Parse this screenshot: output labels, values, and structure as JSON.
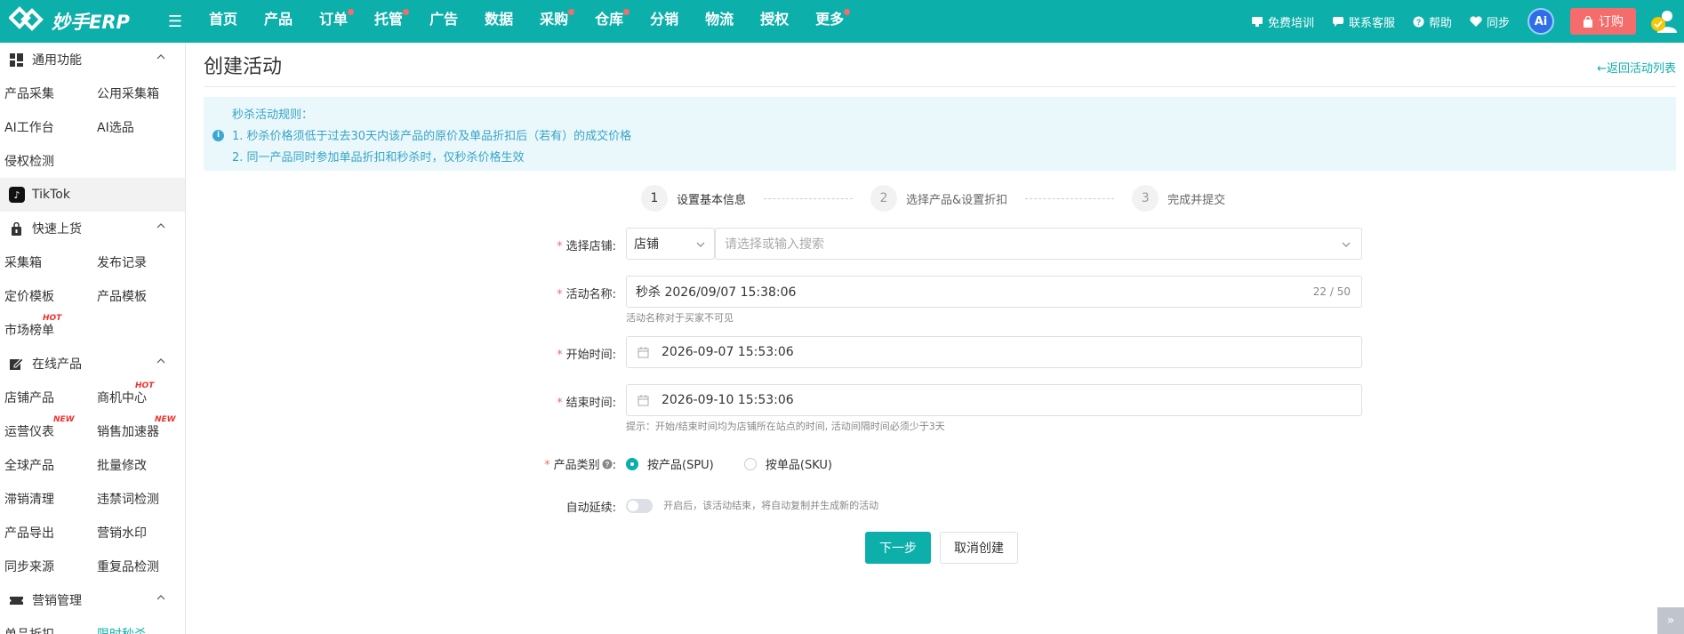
{
  "brand": {
    "name": "妙手ERP",
    "accent": "#0dafab"
  },
  "nav": [
    {
      "label": "首页",
      "dot": false
    },
    {
      "label": "产品",
      "dot": false
    },
    {
      "label": "订单",
      "dot": true
    },
    {
      "label": "托管",
      "dot": true
    },
    {
      "label": "广告",
      "dot": false
    },
    {
      "label": "数据",
      "dot": false
    },
    {
      "label": "采购",
      "dot": true
    },
    {
      "label": "仓库",
      "dot": true
    },
    {
      "label": "分销",
      "dot": false
    },
    {
      "label": "物流",
      "dot": false
    },
    {
      "label": "授权",
      "dot": false
    },
    {
      "label": "更多",
      "dot": true
    }
  ],
  "topright": {
    "training": "免费培训",
    "support": "联系客服",
    "help": "帮助",
    "sync": "同步",
    "ai": "Ai",
    "order": "订购"
  },
  "sidebar": {
    "general": {
      "title": "通用功能",
      "rows": [
        [
          "产品采集",
          "公用采集箱"
        ],
        [
          "AI工作台",
          "AI选品"
        ],
        [
          "侵权检测"
        ]
      ]
    },
    "tiktok": "TikTok",
    "quick": {
      "title": "快速上货",
      "rows": [
        [
          "采集箱",
          "发布记录"
        ],
        [
          "定价模板",
          "产品模板"
        ],
        [
          "市场榜单"
        ]
      ],
      "hot": "HOT"
    },
    "online": {
      "title": "在线产品",
      "r1": [
        "店铺产品",
        "商机中心"
      ],
      "r2": [
        "运营仪表",
        "销售加速器"
      ],
      "rows": [
        [
          "全球产品",
          "批量修改"
        ],
        [
          "滞销清理",
          "违禁词检测"
        ],
        [
          "产品导出",
          "营销水印"
        ],
        [
          "同步来源",
          "重复品检测"
        ]
      ],
      "hot": "HOT",
      "new": "NEW"
    },
    "marketing": {
      "title": "营销管理",
      "items": [
        "单品折扣",
        "限时秒杀"
      ]
    }
  },
  "page": {
    "title": "创建活动",
    "back": "←返回活动列表",
    "notice": {
      "title": "秒杀活动规则：",
      "line1": "1. 秒杀价格须低于过去30天内该产品的原价及单品折扣后（若有）的成交价格",
      "line2": "2. 同一产品同时参加单品折扣和秒杀时，仅秒杀价格生效"
    },
    "steps": [
      {
        "num": "1",
        "label": "设置基本信息"
      },
      {
        "num": "2",
        "label": "选择产品&设置折扣"
      },
      {
        "num": "3",
        "label": "完成并提交"
      }
    ],
    "form": {
      "shop_label": "选择店铺:",
      "shop_type": "店铺",
      "shop_placeholder": "请选择或输入搜索",
      "name_label": "活动名称:",
      "name_value": "秒杀 2026/09/07 15:38:06",
      "name_count": "22 / 50",
      "name_hint": "活动名称对于买家不可见",
      "start_label": "开始时间:",
      "start_value": "2026-09-07 15:53:06",
      "end_label": "结束时间:",
      "end_value": "2026-09-10 15:53:06",
      "time_hint": "提示：开始/结束时间均为店铺所在站点的时间, 活动间隔时间必须少于3天",
      "type_label": "产品类别",
      "type_spu": "按产品(SPU)",
      "type_sku": "按单品(SKU)",
      "auto_label": "自动延续:",
      "auto_hint": "开启后，该活动结束，将自动复制并生成新的活动",
      "next": "下一步",
      "cancel": "取消创建"
    }
  }
}
